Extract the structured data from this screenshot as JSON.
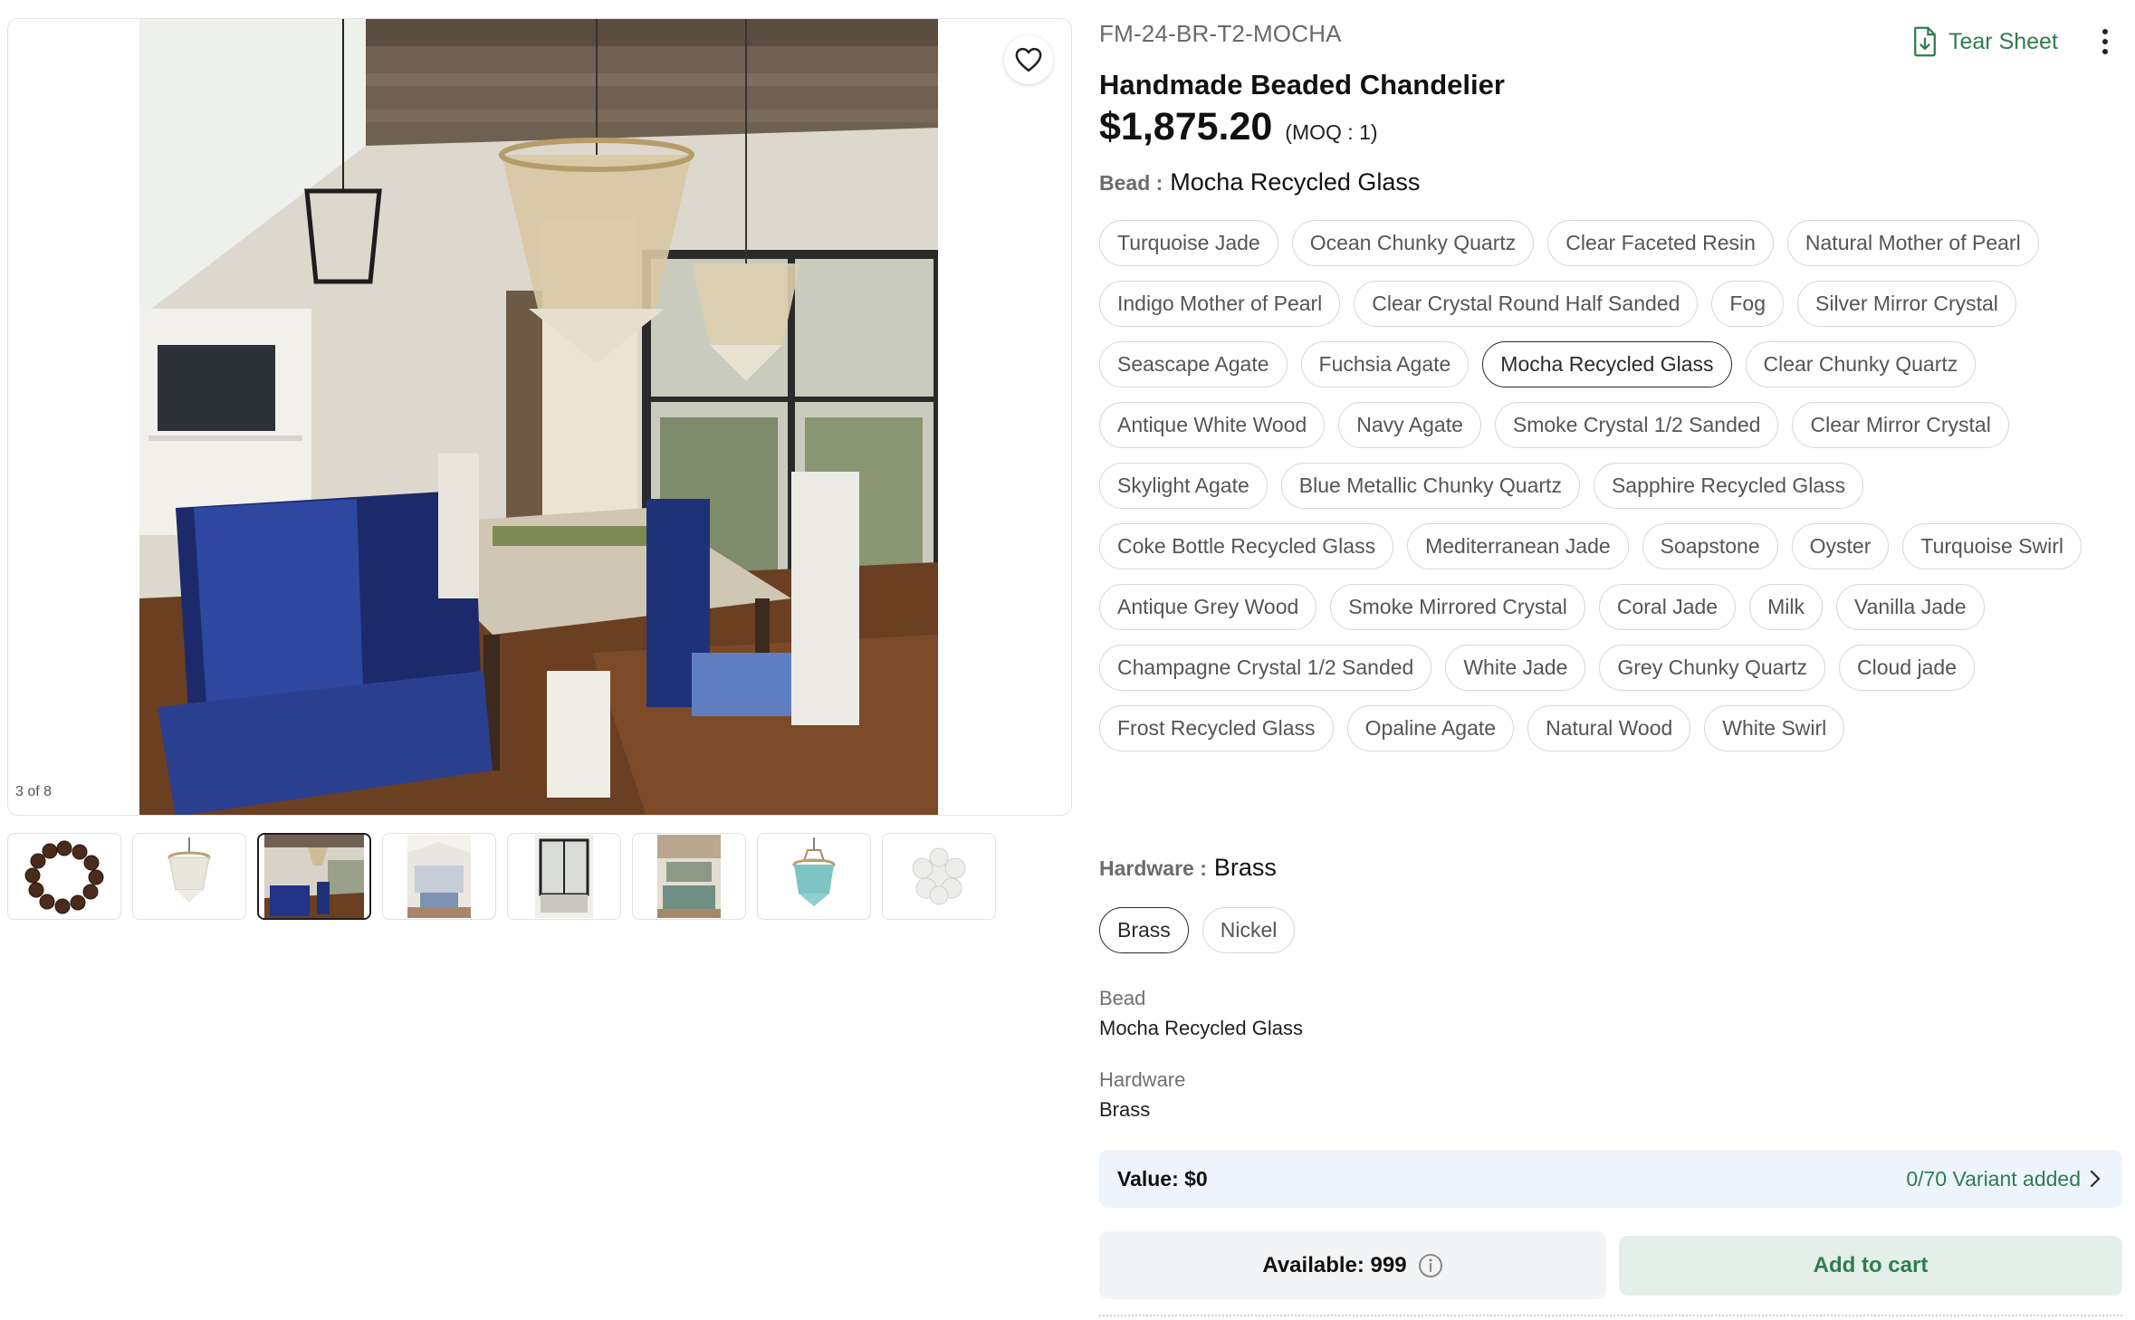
{
  "gallery": {
    "counter": "3 of 8",
    "thumbnails": [
      {
        "icon": "bead-strand"
      },
      {
        "icon": "beaded-chandelier-clear"
      },
      {
        "icon": "dining-room-photo",
        "active": true
      },
      {
        "icon": "living-room-photo"
      },
      {
        "icon": "interior-window-photo"
      },
      {
        "icon": "kitchen-photo"
      },
      {
        "icon": "beaded-chandelier-turquoise"
      },
      {
        "icon": "pearl-beads-cluster"
      }
    ]
  },
  "product": {
    "sku": "FM-24-BR-T2-MOCHA",
    "title": "Handmade Beaded Chandelier",
    "price": "$1,875.20",
    "moq": "(MOQ : 1)"
  },
  "actions": {
    "tear_sheet": "Tear Sheet"
  },
  "bead": {
    "label": "Bead :",
    "selected": "Mocha Recycled Glass",
    "options": [
      "Turquoise Jade",
      "Ocean Chunky Quartz",
      "Clear Faceted Resin",
      "Natural Mother of Pearl",
      "Indigo Mother of Pearl",
      "Clear Crystal Round Half Sanded",
      "Fog",
      "Silver Mirror Crystal",
      "Seascape Agate",
      "Fuchsia Agate",
      "Mocha Recycled Glass",
      "Clear Chunky Quartz",
      "Antique White Wood",
      "Navy Agate",
      "Smoke Crystal 1/2 Sanded",
      "Clear Mirror Crystal",
      "Skylight Agate",
      "Blue Metallic Chunky Quartz",
      "Sapphire Recycled Glass",
      "Coke Bottle Recycled Glass",
      "Mediterranean Jade",
      "Soapstone",
      "Oyster",
      "Turquoise Swirl",
      "Antique Grey Wood",
      "Smoke Mirrored Crystal",
      "Coral Jade",
      "Milk",
      "Vanilla Jade",
      "Champagne Crystal 1/2 Sanded",
      "White Jade",
      "Grey Chunky Quartz",
      "Cloud jade",
      "Frost Recycled Glass",
      "Opaline Agate",
      "Natural Wood",
      "White Swirl"
    ]
  },
  "hardware": {
    "label": "Hardware :",
    "selected": "Brass",
    "options": [
      "Brass",
      "Nickel"
    ]
  },
  "summary": {
    "bead_key": "Bead",
    "bead_val": "Mocha Recycled Glass",
    "hardware_key": "Hardware",
    "hardware_val": "Brass"
  },
  "cart": {
    "value": "Value: $0",
    "variants": "0/70 Variant added",
    "available": "Available: 999",
    "add_to_cart": "Add to cart"
  },
  "colors": {
    "accent_green": "#2e7d4f",
    "value_bar_bg": "#edf4fc",
    "add_cart_bg": "#e3efe8"
  }
}
